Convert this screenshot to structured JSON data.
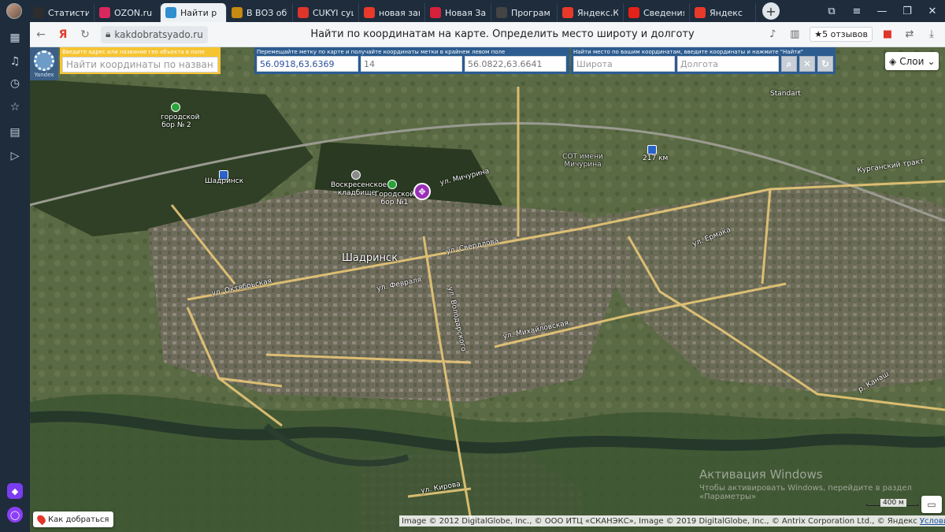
{
  "browser": {
    "tabs": [
      {
        "label": "Статистик",
        "icon": "plus-icon",
        "color": "#2d2d2d",
        "active": false
      },
      {
        "label": "OZON.ru -",
        "icon": "ozon-icon",
        "color": "#d8285e",
        "active": false
      },
      {
        "label": "Найти р",
        "icon": "globe-icon",
        "color": "#2f8fd0",
        "active": true
      },
      {
        "label": "В ВОЗ объ",
        "icon": "flag-icon",
        "color": "#c48a12",
        "active": false
      },
      {
        "label": "CUKYI суш",
        "icon": "mail-icon",
        "color": "#e0352b",
        "active": false
      },
      {
        "label": "новая зав",
        "icon": "yandex-icon",
        "color": "#e8392b",
        "active": false
      },
      {
        "label": "Новая Зав",
        "icon": "opera-icon",
        "color": "#d6203b",
        "active": false
      },
      {
        "label": "Програм",
        "icon": "screen-icon",
        "color": "#444444",
        "active": false
      },
      {
        "label": "Яндекс.Ко",
        "icon": "collections-icon",
        "color": "#e8392b",
        "active": false
      },
      {
        "label": "Сведения",
        "icon": "youtube-icon",
        "color": "#e62117",
        "active": false
      },
      {
        "label": "Яндекс",
        "icon": "yandex-icon",
        "color": "#e8392b",
        "active": false
      }
    ],
    "new_tab": "+",
    "address": {
      "url": "kakdobratsyado.ru",
      "page_title": "Найти по координатам на карте. Определить место широту и долготу",
      "reviews": "★5 отзывов",
      "yandex_letter": "Я"
    }
  },
  "map_ui": {
    "logo_text": "Yandex",
    "search": {
      "hint": "Введите адрес или название гео объекта в поле",
      "placeholder": "Найти координаты по названию"
    },
    "coords": {
      "hint": "Перемещайте метку по карте и получайте координаты метки в крайнем левом поле",
      "marker_coords": "56.0918,63.6369",
      "zoom": "14",
      "center_coords": "56.0822,63.6641"
    },
    "find": {
      "hint": "Найти место по вашим координатам, введите координаты и нажмите \"Найти\"",
      "lat_placeholder": "Широта",
      "lon_placeholder": "Долгота"
    },
    "layers_label": "Слои",
    "route_label": "Как добраться",
    "copyright": "Image © 2012 DigitalGlobe, Inc., © ООО ИТЦ «СКАНЭКС», Image © 2019 DigitalGlobe, Inc., © Antrix Corporation Ltd., © Яндекс",
    "terms": "Условия использования",
    "scale": "400 м",
    "watermark_title": "Активация Windows",
    "watermark_sub": "Чтобы активировать Windows, перейдите в раздел «Параметры»"
  },
  "map_labels": {
    "city": "Шадринск",
    "bor2": "городской бор № 2",
    "bor1": "Городской бор №1",
    "cemetery": "Воскресенское кладбище",
    "station": "Шадринск",
    "km217": "217 км",
    "sot": "СОТ имени Мичурина",
    "standart": "Standart",
    "street1": "ул. Свердлова",
    "street2": "ул. Кирова",
    "street3": "ул. Михайловская",
    "street4": "ул. Февраля",
    "street5": "ул. Володарского",
    "street6": "ул. Мичурина",
    "street7": "Курганский тракт",
    "street8": "р. Канаш",
    "street9": "ул. Ермака",
    "street10": "ул. Октябрьская"
  }
}
